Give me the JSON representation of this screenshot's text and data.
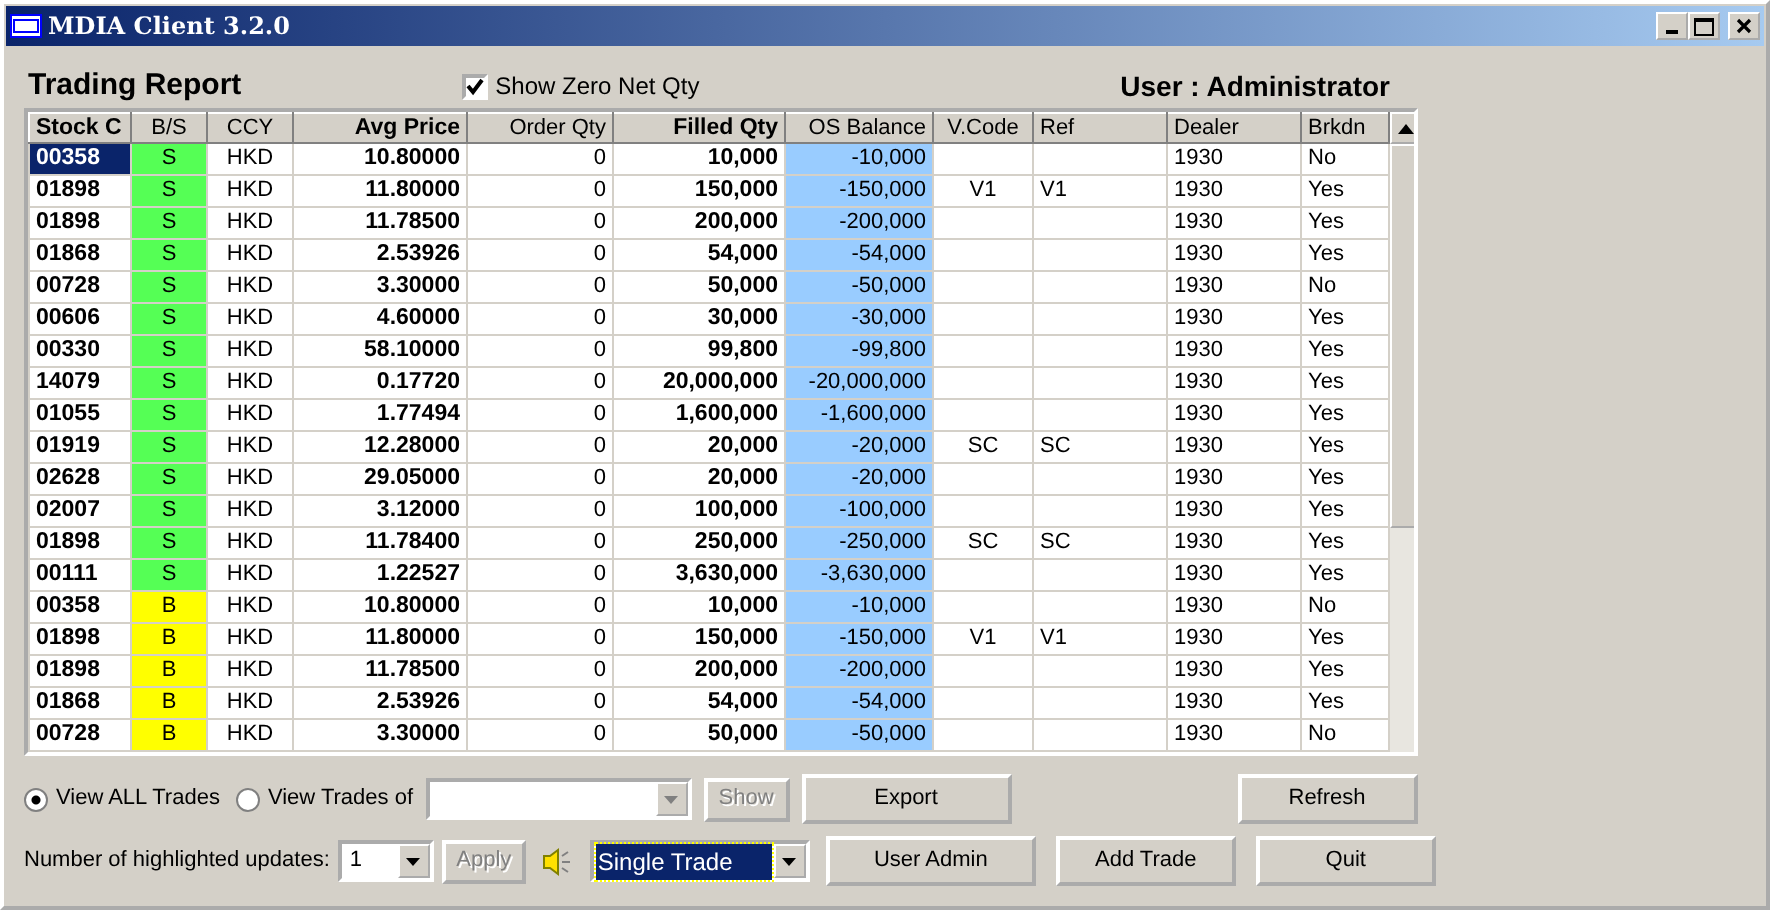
{
  "window": {
    "title": "MDIA Client 3.2.0"
  },
  "header": {
    "title": "Trading Report",
    "show_zero": {
      "label": "Show Zero Net Qty",
      "checked": true
    },
    "user": "User : Administrator"
  },
  "table": {
    "columns": [
      "Stock C",
      "B/S",
      "CCY",
      "Avg Price",
      "Order Qty",
      "Filled Qty",
      "OS Balance",
      "V.Code",
      "Ref",
      "Dealer",
      "Brkdn"
    ],
    "rows": [
      {
        "selected": true,
        "cells": [
          "00358",
          "S",
          "HKD",
          "10.80000",
          "0",
          "10,000",
          "-10,000",
          "",
          "",
          "1930",
          "No"
        ],
        "color": "#55ff55"
      },
      {
        "selected": false,
        "cells": [
          "01898",
          "S",
          "HKD",
          "11.80000",
          "0",
          "150,000",
          "-150,000",
          "V1",
          "V1",
          "1930",
          "Yes"
        ],
        "color": "#55ff55"
      },
      {
        "selected": false,
        "cells": [
          "01898",
          "S",
          "HKD",
          "11.78500",
          "0",
          "200,000",
          "-200,000",
          "",
          "",
          "1930",
          "Yes"
        ],
        "color": "#55ff55"
      },
      {
        "selected": false,
        "cells": [
          "01868",
          "S",
          "HKD",
          "2.53926",
          "0",
          "54,000",
          "-54,000",
          "",
          "",
          "1930",
          "Yes"
        ],
        "color": "#55ff55"
      },
      {
        "selected": false,
        "cells": [
          "00728",
          "S",
          "HKD",
          "3.30000",
          "0",
          "50,000",
          "-50,000",
          "",
          "",
          "1930",
          "No"
        ],
        "color": "#55ff55"
      },
      {
        "selected": false,
        "cells": [
          "00606",
          "S",
          "HKD",
          "4.60000",
          "0",
          "30,000",
          "-30,000",
          "",
          "",
          "1930",
          "Yes"
        ],
        "color": "#55ff55"
      },
      {
        "selected": false,
        "cells": [
          "00330",
          "S",
          "HKD",
          "58.10000",
          "0",
          "99,800",
          "-99,800",
          "",
          "",
          "1930",
          "Yes"
        ],
        "color": "#55ff55"
      },
      {
        "selected": false,
        "cells": [
          "14079",
          "S",
          "HKD",
          "0.17720",
          "0",
          "20,000,000",
          "-20,000,000",
          "",
          "",
          "1930",
          "Yes"
        ],
        "color": "#55ff55"
      },
      {
        "selected": false,
        "cells": [
          "01055",
          "S",
          "HKD",
          "1.77494",
          "0",
          "1,600,000",
          "-1,600,000",
          "",
          "",
          "1930",
          "Yes"
        ],
        "color": "#55ff55"
      },
      {
        "selected": false,
        "cells": [
          "01919",
          "S",
          "HKD",
          "12.28000",
          "0",
          "20,000",
          "-20,000",
          "SC",
          "SC",
          "1930",
          "Yes"
        ],
        "color": "#55ff55"
      },
      {
        "selected": false,
        "cells": [
          "02628",
          "S",
          "HKD",
          "29.05000",
          "0",
          "20,000",
          "-20,000",
          "",
          "",
          "1930",
          "Yes"
        ],
        "color": "#55ff55"
      },
      {
        "selected": false,
        "cells": [
          "02007",
          "S",
          "HKD",
          "3.12000",
          "0",
          "100,000",
          "-100,000",
          "",
          "",
          "1930",
          "Yes"
        ],
        "color": "#55ff55"
      },
      {
        "selected": false,
        "cells": [
          "01898",
          "S",
          "HKD",
          "11.78400",
          "0",
          "250,000",
          "-250,000",
          "SC",
          "SC",
          "1930",
          "Yes"
        ],
        "color": "#55ff55"
      },
      {
        "selected": false,
        "cells": [
          "00111",
          "S",
          "HKD",
          "1.22527",
          "0",
          "3,630,000",
          "-3,630,000",
          "",
          "",
          "1930",
          "Yes"
        ],
        "color": "#55ff55"
      },
      {
        "selected": false,
        "cells": [
          "00358",
          "B",
          "HKD",
          "10.80000",
          "0",
          "10,000",
          "-10,000",
          "",
          "",
          "1930",
          "No"
        ],
        "color": "#ffff00"
      },
      {
        "selected": false,
        "cells": [
          "01898",
          "B",
          "HKD",
          "11.80000",
          "0",
          "150,000",
          "-150,000",
          "V1",
          "V1",
          "1930",
          "Yes"
        ],
        "color": "#ffff00"
      },
      {
        "selected": false,
        "cells": [
          "01898",
          "B",
          "HKD",
          "11.78500",
          "0",
          "200,000",
          "-200,000",
          "",
          "",
          "1930",
          "Yes"
        ],
        "color": "#ffff00"
      },
      {
        "selected": false,
        "cells": [
          "01868",
          "B",
          "HKD",
          "2.53926",
          "0",
          "54,000",
          "-54,000",
          "",
          "",
          "1930",
          "Yes"
        ],
        "color": "#ffff00"
      },
      {
        "selected": false,
        "cells": [
          "00728",
          "B",
          "HKD",
          "3.30000",
          "0",
          "50,000",
          "-50,000",
          "",
          "",
          "1930",
          "No"
        ],
        "color": "#ffff00"
      }
    ]
  },
  "view_options": [
    {
      "label": "View ALL Trades",
      "selected": true
    },
    {
      "label": "View Trades of",
      "selected": false
    }
  ],
  "show_button": {
    "label": "Show",
    "disabled": true
  },
  "highlight": {
    "label": "Number of highlighted updates:",
    "value": "1",
    "apply": {
      "label": "Apply",
      "disabled": true
    },
    "sound_mode": "Single Trade"
  },
  "buttons": [
    {
      "label": "Export"
    },
    {
      "label": "Refresh"
    },
    {
      "label": "User Admin"
    },
    {
      "label": "Add Trade"
    },
    {
      "label": "Quit"
    }
  ]
}
